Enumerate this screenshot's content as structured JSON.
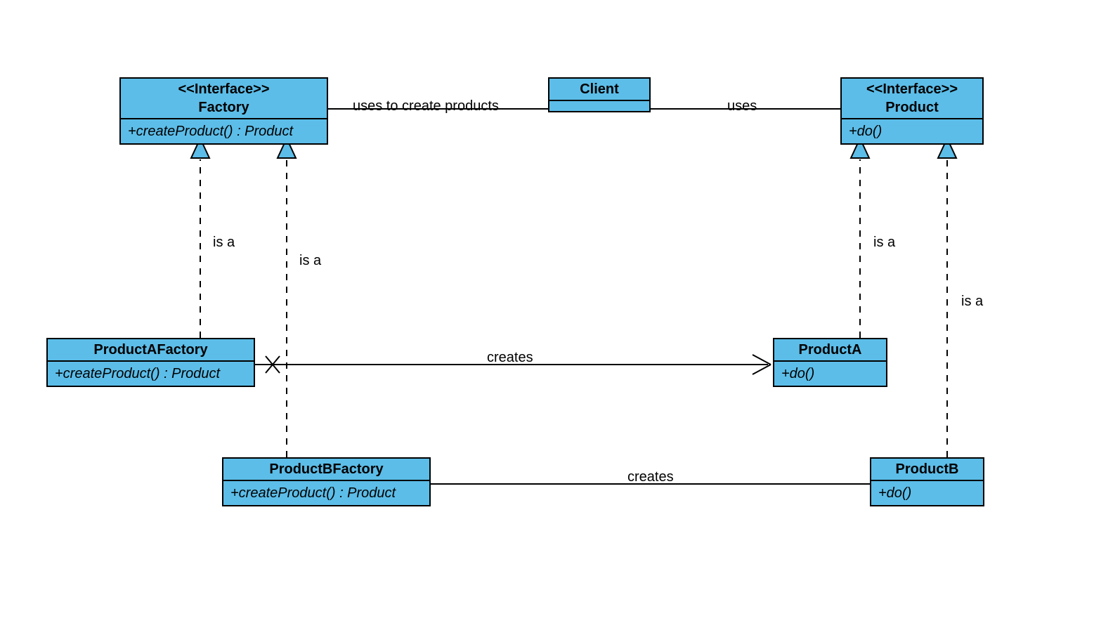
{
  "classes": {
    "factory": {
      "stereotype": "<<Interface>>",
      "name": "Factory",
      "method": "+createProduct() : Product"
    },
    "client": {
      "name": "Client"
    },
    "product": {
      "stereotype": "<<Interface>>",
      "name": "Product",
      "method": "+do()"
    },
    "productAFactory": {
      "name": "ProductAFactory",
      "method": "+createProduct() : Product"
    },
    "productBFactory": {
      "name": "ProductBFactory",
      "method": "+createProduct() : Product"
    },
    "productA": {
      "name": "ProductA",
      "method": "+do()"
    },
    "productB": {
      "name": "ProductB",
      "method": "+do()"
    }
  },
  "relations": {
    "usesCreate": "uses to create products",
    "uses": "uses",
    "creates": "creates",
    "isA": "is a"
  },
  "style": {
    "boxFill": "#5cbde8",
    "arrowFill": "#5cbde8"
  }
}
